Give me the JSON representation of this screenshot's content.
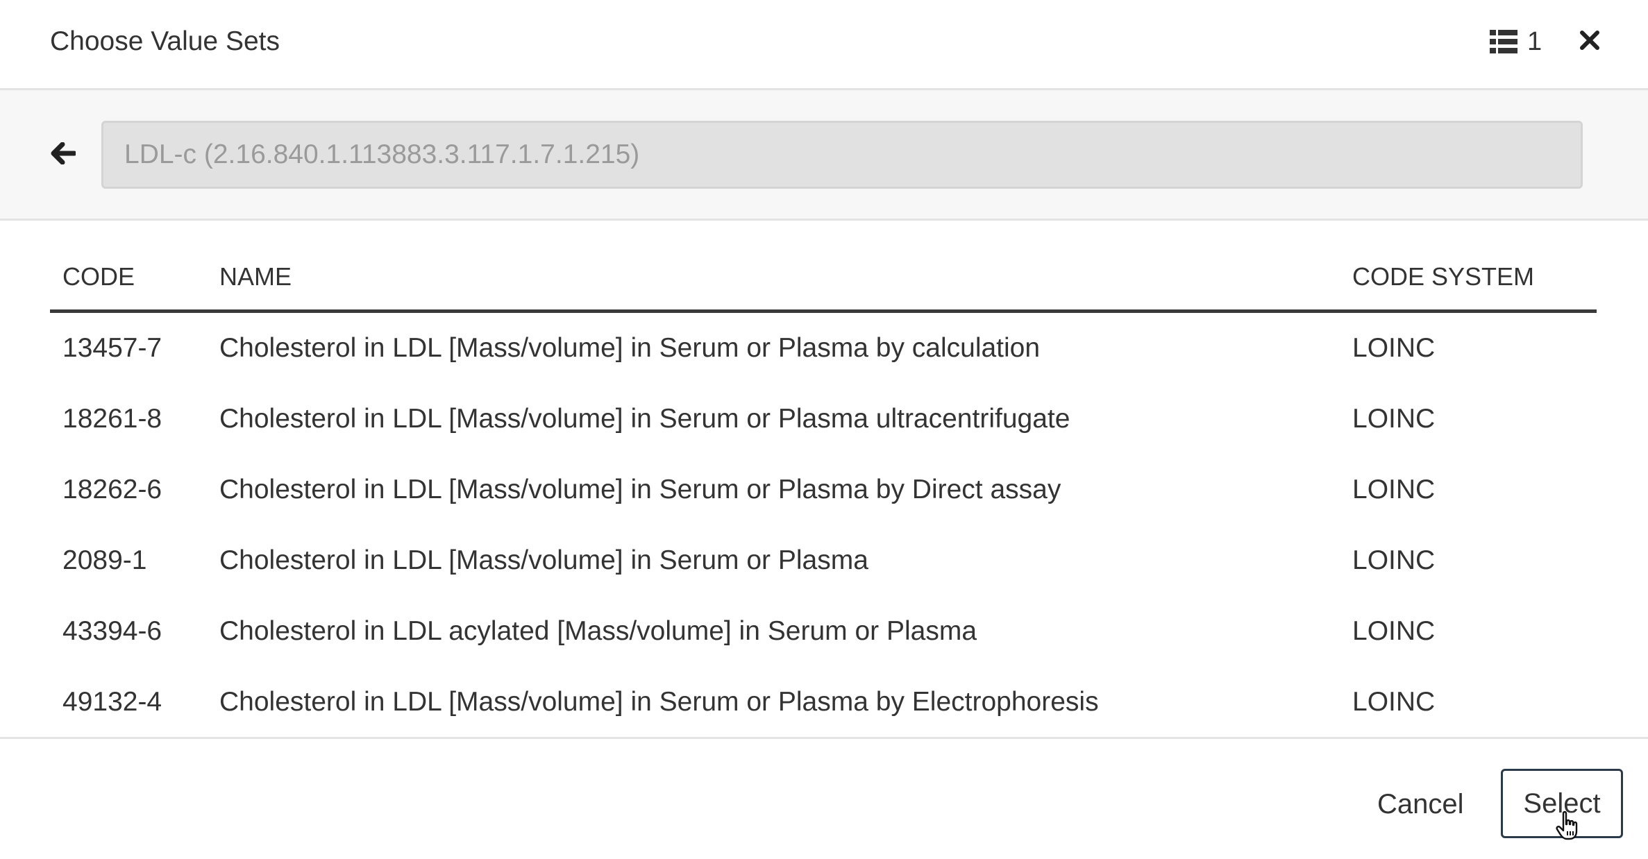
{
  "header": {
    "title": "Choose Value Sets",
    "selected_count": "1"
  },
  "search": {
    "value": "",
    "placeholder": "LDL-c (2.16.840.1.113883.3.117.1.7.1.215)"
  },
  "table": {
    "columns": [
      "CODE",
      "NAME",
      "CODE SYSTEM"
    ],
    "rows": [
      {
        "code": "13457-7",
        "name": "Cholesterol in LDL [Mass/volume] in Serum or Plasma by calculation",
        "system": "LOINC"
      },
      {
        "code": "18261-8",
        "name": "Cholesterol in LDL [Mass/volume] in Serum or Plasma ultracentrifugate",
        "system": "LOINC"
      },
      {
        "code": "18262-6",
        "name": "Cholesterol in LDL [Mass/volume] in Serum or Plasma by Direct assay",
        "system": "LOINC"
      },
      {
        "code": "2089-1",
        "name": "Cholesterol in LDL [Mass/volume] in Serum or Plasma",
        "system": "LOINC"
      },
      {
        "code": "43394-6",
        "name": "Cholesterol in LDL acylated [Mass/volume] in Serum or Plasma",
        "system": "LOINC"
      },
      {
        "code": "49132-4",
        "name": "Cholesterol in LDL [Mass/volume] in Serum or Plasma by Electrophoresis",
        "system": "LOINC"
      }
    ]
  },
  "footer": {
    "cancel_label": "Cancel",
    "select_label": "Select"
  },
  "icons": {
    "list": "list-icon",
    "close": "close-icon",
    "back": "arrow-left-icon",
    "cursor": "hand-pointer-icon"
  },
  "colors": {
    "text": "#333333",
    "border": "#e3e3e3",
    "input_bg": "#e1e1e1",
    "placeholder": "#9a9a9a",
    "table_rule": "#3a3a3a",
    "select_border": "#2b3a4a"
  }
}
